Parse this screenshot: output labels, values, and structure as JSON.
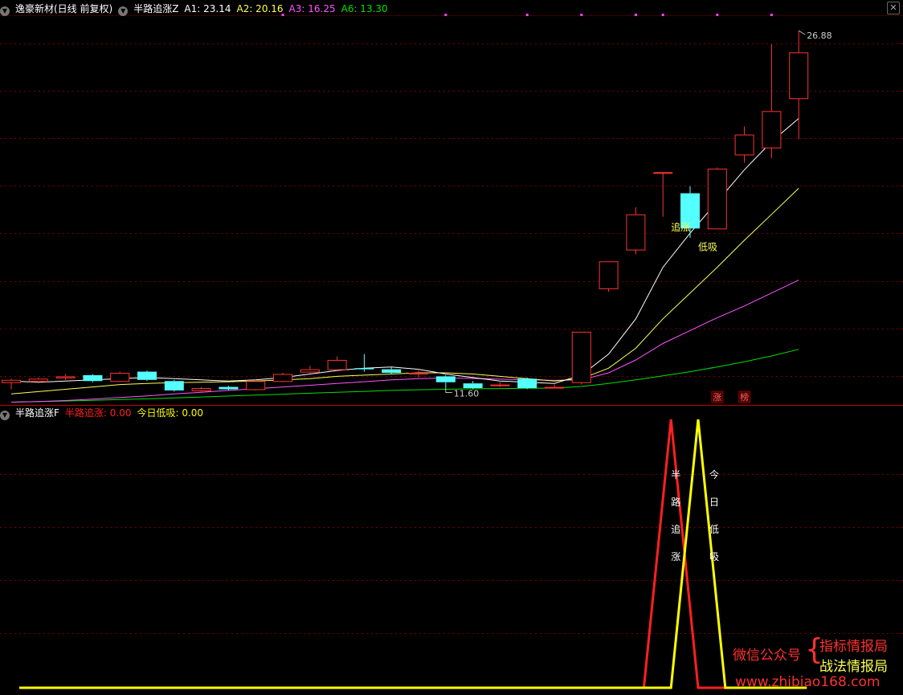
{
  "main_header": {
    "stock": "逸豪新材(日线 前复权)",
    "indicator": "半路追涨Z",
    "a1": "A1: 23.14",
    "a2": "A2: 20.16",
    "a3": "A3: 16.25",
    "a6": "A6: 13.30"
  },
  "sub_header": {
    "indicator": "半路追涨F",
    "v1": "半路追涨: 0.00",
    "v2": "今日低吸: 0.00"
  },
  "watermark": {
    "left": "微信公众号",
    "right_top": "指标情报局",
    "right_bottom": "战法情报局",
    "url": "www.zhibiao168.com"
  },
  "colors": {
    "up": "#ff3232",
    "down": "#54ffff",
    "ma1": "#ffffff",
    "ma2": "#ffff54",
    "ma3": "#ff54ff",
    "ma6": "#00e000",
    "grid": "#7a0000",
    "signal_red": "#ff2020",
    "signal_yellow": "#ffff00"
  },
  "chart_data": [
    {
      "type": "candlestick",
      "ylim": [
        11.0,
        27.5
      ],
      "annotations": {
        "max_label": "26.88",
        "min_label": "11.60",
        "chase_label": "追涨",
        "dip_label": "低吸",
        "limit_up_badge": "涨",
        "rank_badge": "榜"
      },
      "candles": [
        {
          "o": 11.9,
          "c": 12.0,
          "h": 12.05,
          "l": 11.6
        },
        {
          "o": 11.95,
          "c": 12.05,
          "h": 12.1,
          "l": 11.85
        },
        {
          "o": 12.1,
          "c": 12.15,
          "h": 12.25,
          "l": 12.0
        },
        {
          "o": 12.2,
          "c": 11.95,
          "h": 12.25,
          "l": 11.9
        },
        {
          "o": 11.95,
          "c": 12.3,
          "h": 12.35,
          "l": 11.9
        },
        {
          "o": 12.35,
          "c": 12.0,
          "h": 12.4,
          "l": 11.95
        },
        {
          "o": 11.95,
          "c": 11.55,
          "h": 12.0,
          "l": 11.5
        },
        {
          "o": 11.55,
          "c": 11.65,
          "h": 11.7,
          "l": 11.5
        },
        {
          "o": 11.7,
          "c": 11.6,
          "h": 11.75,
          "l": 11.55
        },
        {
          "o": 11.6,
          "c": 11.95,
          "h": 12.0,
          "l": 11.55
        },
        {
          "o": 11.95,
          "c": 12.25,
          "h": 12.3,
          "l": 11.9
        },
        {
          "o": 12.35,
          "c": 12.45,
          "h": 12.6,
          "l": 12.3
        },
        {
          "o": 12.45,
          "c": 12.85,
          "h": 13.0,
          "l": 12.4
        },
        {
          "o": 12.5,
          "c": 12.45,
          "h": 13.1,
          "l": 12.35
        },
        {
          "o": 12.45,
          "c": 12.3,
          "h": 12.55,
          "l": 12.25
        },
        {
          "o": 12.3,
          "c": 12.3,
          "h": 12.4,
          "l": 12.1
        },
        {
          "o": 12.15,
          "c": 11.9,
          "h": 12.2,
          "l": 11.6
        },
        {
          "o": 11.85,
          "c": 11.65,
          "h": 11.95,
          "l": 11.6
        },
        {
          "o": 11.8,
          "c": 11.8,
          "h": 11.9,
          "l": 11.7
        },
        {
          "o": 12.05,
          "c": 11.65,
          "h": 12.1,
          "l": 11.6
        },
        {
          "o": 11.7,
          "c": 11.7,
          "h": 11.8,
          "l": 11.65
        },
        {
          "o": 11.9,
          "c": 14.05,
          "h": 14.05,
          "l": 11.8
        },
        {
          "o": 15.9,
          "c": 17.05,
          "h": 17.05,
          "l": 15.75
        },
        {
          "o": 17.55,
          "c": 19.05,
          "h": 19.35,
          "l": 17.35
        },
        {
          "o": 20.85,
          "c": 20.85,
          "h": 20.85,
          "l": 18.95
        },
        {
          "o": 19.95,
          "c": 18.45,
          "h": 20.25,
          "l": 18.05
        },
        {
          "o": 18.45,
          "c": 21.0,
          "h": 21.05,
          "l": 18.45
        },
        {
          "o": 21.6,
          "c": 22.45,
          "h": 22.8,
          "l": 21.25
        },
        {
          "o": 21.9,
          "c": 23.45,
          "h": 26.3,
          "l": 21.45
        },
        {
          "o": 24.0,
          "c": 25.95,
          "h": 26.88,
          "l": 22.25
        }
      ],
      "ma1": [
        11.95,
        11.9,
        11.95,
        12.0,
        12.05,
        12.1,
        12.05,
        12.0,
        11.95,
        12.0,
        12.1,
        12.25,
        12.4,
        12.5,
        12.55,
        12.45,
        12.25,
        12.1,
        11.95,
        11.9,
        11.85,
        12.2,
        13.1,
        14.6,
        16.8,
        18.25,
        19.6,
        20.95,
        22.15,
        23.14
      ],
      "ma2": [
        11.4,
        11.5,
        11.6,
        11.7,
        11.8,
        11.85,
        11.88,
        11.9,
        11.92,
        11.95,
        12.0,
        12.05,
        12.15,
        12.2,
        12.25,
        12.3,
        12.3,
        12.25,
        12.15,
        12.05,
        11.95,
        12.05,
        12.5,
        13.35,
        14.6,
        15.7,
        16.8,
        17.95,
        19.05,
        20.16
      ],
      "ma3": [
        11.05,
        11.08,
        11.12,
        11.18,
        11.25,
        11.32,
        11.4,
        11.47,
        11.55,
        11.62,
        11.7,
        11.77,
        11.85,
        11.92,
        12.0,
        12.05,
        12.08,
        12.06,
        12.03,
        12.0,
        11.98,
        12.0,
        12.3,
        12.85,
        13.55,
        14.1,
        14.65,
        15.15,
        15.7,
        16.25
      ],
      "ma6": [
        11.05,
        11.08,
        11.1,
        11.13,
        11.16,
        11.19,
        11.23,
        11.27,
        11.31,
        11.35,
        11.39,
        11.43,
        11.47,
        11.51,
        11.55,
        11.58,
        11.6,
        11.62,
        11.63,
        11.64,
        11.65,
        11.72,
        11.85,
        12.0,
        12.17,
        12.35,
        12.55,
        12.77,
        13.02,
        13.3
      ]
    },
    {
      "type": "line",
      "ylim": [
        0,
        1
      ],
      "labels": {
        "chase_chars": [
          "半",
          "路",
          "追",
          "涨"
        ],
        "dip_chars": [
          "今",
          "日",
          "低",
          "吸"
        ]
      },
      "series": [
        {
          "name": "半路追涨",
          "values": [
            0,
            0,
            0,
            0,
            0,
            0,
            0,
            0,
            0,
            0,
            0,
            0,
            0,
            0,
            0,
            0,
            0,
            0,
            0,
            0,
            0,
            0,
            0,
            0,
            1,
            0,
            0,
            0,
            0,
            0
          ]
        },
        {
          "name": "今日低吸",
          "values": [
            0,
            0,
            0,
            0,
            0,
            0,
            0,
            0,
            0,
            0,
            0,
            0,
            0,
            0,
            0,
            0,
            0,
            0,
            0,
            0,
            0,
            0,
            0,
            0,
            0,
            1,
            0,
            0,
            0,
            0
          ]
        }
      ]
    }
  ]
}
